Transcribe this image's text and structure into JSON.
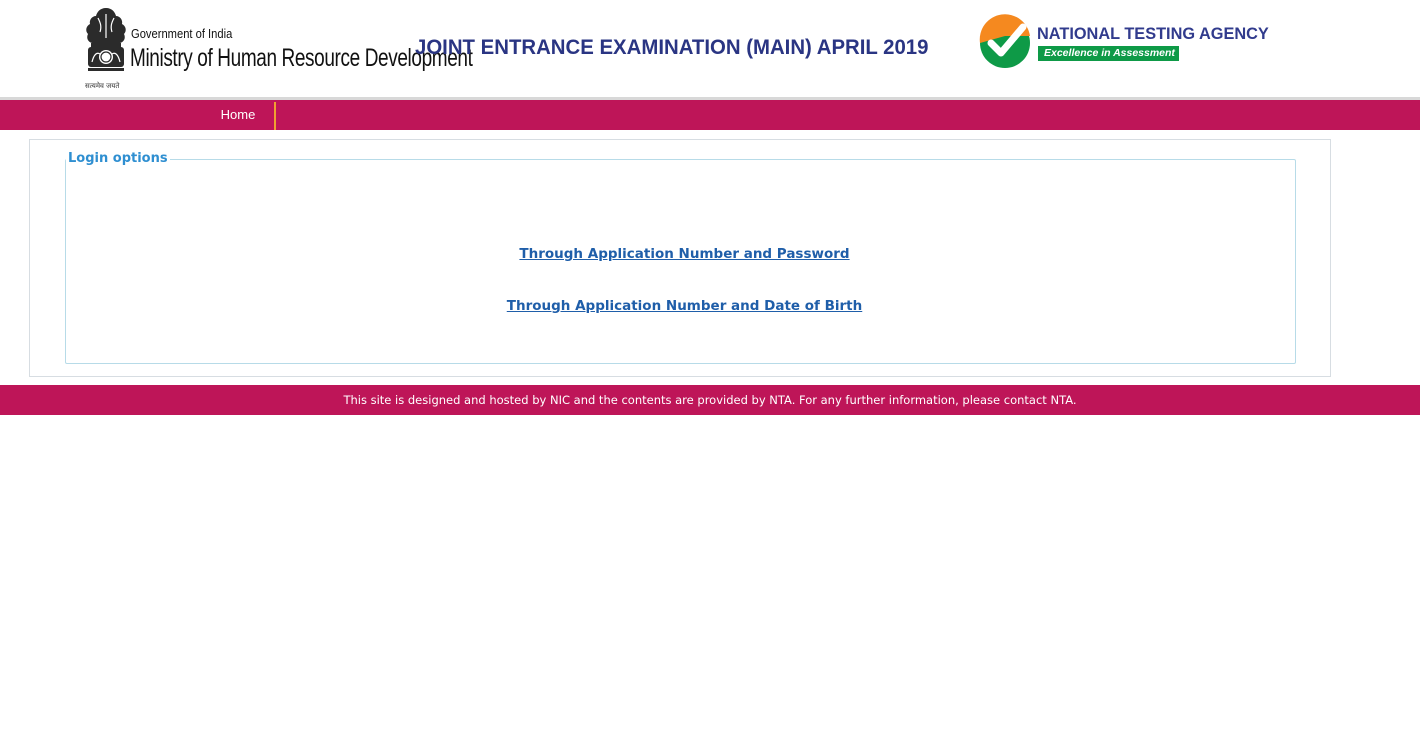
{
  "header": {
    "gov_line": "Government of India",
    "ministry_line": "Ministry of Human Resource Development",
    "motto": "सत्यमेव जयते",
    "exam_title": "JOINT ENTRANCE EXAMINATION (MAIN) APRIL 2019",
    "nta_name": "NATIONAL TESTING AGENCY",
    "nta_tagline": "Excellence in Assessment"
  },
  "nav": {
    "home_label": "Home"
  },
  "login": {
    "legend": "Login options",
    "options": [
      {
        "label": "Through Application Number and Password"
      },
      {
        "label": "Through Application Number and Date of Birth"
      }
    ]
  },
  "footer": {
    "text": "This site is designed and hosted by NIC and the contents are provided by NTA. For any further information, please contact NTA."
  },
  "colors": {
    "brand_bar": "#be1558",
    "title_blue": "#2a3583",
    "nta_blue": "#313b8d",
    "nta_green": "#0e9a47",
    "nta_orange": "#f5891f",
    "link_blue": "#1f5ea9",
    "legend_blue": "#2f8fd1",
    "nav_separator": "#f0a030"
  },
  "icons": {
    "emblem": "state-emblem-icon",
    "nta_logo": "nta-checkmark-logo"
  }
}
